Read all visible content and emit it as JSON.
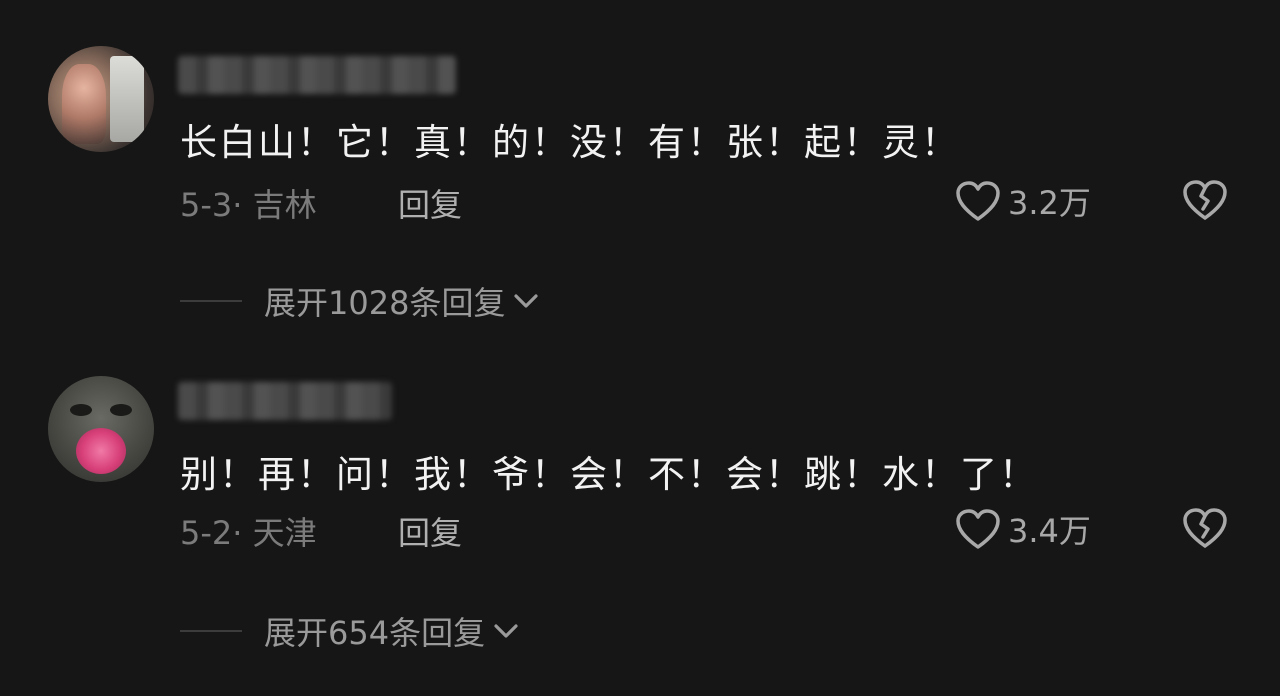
{
  "comments": [
    {
      "text": "长白山！它！真！的！没！有！张！起！灵！",
      "meta": "5-3· 吉林",
      "reply_label": "回复",
      "likes": "3.2万",
      "expand_label": "展开1028条回复"
    },
    {
      "text": "别！再！问！我！爷！会！不！会！跳！水！了！",
      "meta": "5-2· 天津",
      "reply_label": "回复",
      "likes": "3.4万",
      "expand_label": "展开654条回复"
    }
  ],
  "icons": {
    "like": "heart-outline-icon",
    "dislike": "broken-heart-icon",
    "expand": "chevron-down-icon"
  },
  "colors": {
    "background": "#161616",
    "text": "#f2f2f2",
    "meta": "#7b7b7b",
    "accent_gray": "#a8a8a8"
  }
}
